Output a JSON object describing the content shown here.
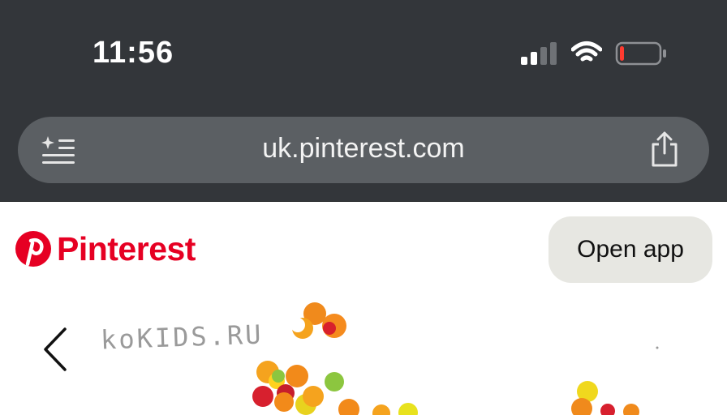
{
  "status_bar": {
    "time": "11:56",
    "signal_icon": "cellular-signal-icon",
    "wifi_icon": "wifi-icon",
    "battery_icon": "battery-low-icon",
    "battery_level": 0.08,
    "battery_color": "#ff3b30"
  },
  "browser": {
    "url": "uk.pinterest.com",
    "reader_icon": "reader-mode-icon",
    "share_icon": "share-icon"
  },
  "header": {
    "logo_text": "Pinterest",
    "logo_icon": "pinterest-logo-icon",
    "open_app_label": "Open app",
    "brand_color": "#e60023"
  },
  "pin": {
    "back_icon": "chevron-left-icon",
    "watermark": "koKIDS.RU",
    "image_icon": "colorful-confetti-dots-image"
  }
}
